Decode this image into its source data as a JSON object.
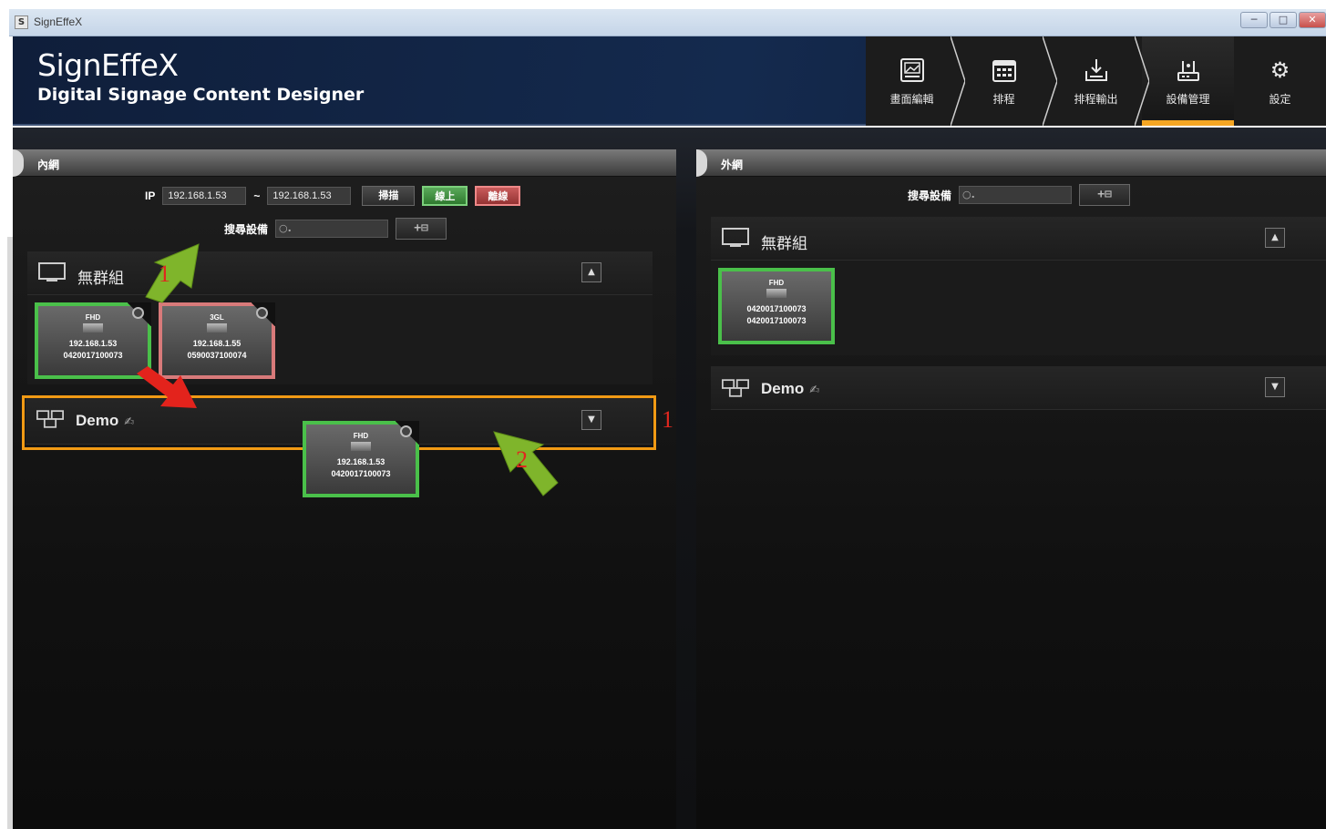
{
  "window": {
    "title": "SignEffeX",
    "icon_letter": "S",
    "controls": [
      "─",
      "□",
      "✕"
    ]
  },
  "header": {
    "brand": "SignEffeX",
    "tagline": "Digital Signage Content Designer"
  },
  "nav": [
    {
      "label": "畫面編輯",
      "icon": "image-edit-icon",
      "active": false
    },
    {
      "label": "排程",
      "icon": "calendar-icon",
      "active": false
    },
    {
      "label": "排程輸出",
      "icon": "download-icon",
      "active": false
    },
    {
      "label": "設備管理",
      "icon": "network-device-icon",
      "active": true
    },
    {
      "label": "設定",
      "icon": "gear-icon",
      "active": false
    }
  ],
  "left_panel": {
    "title": "內網",
    "ip_label": "IP",
    "ip_start": "192.168.1.53",
    "ip_separator": "~",
    "ip_end": "192.168.1.53",
    "scan_button": "掃描",
    "online_button": "線上",
    "offline_button": "離線",
    "search_label": "搜尋設備",
    "search_placeholder": "",
    "add_group_glyph": "+⊟",
    "ungrouped": {
      "name": "無群組",
      "toggle": "▲",
      "devices": [
        {
          "res": "FHD",
          "line1": "192.168.1.53",
          "line2": "0420017100073",
          "status": "online"
        },
        {
          "res": "3GL",
          "line1": "192.168.1.55",
          "line2": "0590037100074",
          "status": "offline"
        }
      ]
    },
    "demo_group": {
      "name": "Demo",
      "toggle": "▼",
      "dragged_device": {
        "res": "FHD",
        "line1": "192.168.1.53",
        "line2": "0420017100073"
      }
    },
    "annotations": {
      "arrow_1": "1",
      "arrow_2": "2",
      "outline_1": "1"
    }
  },
  "right_panel": {
    "title": "外網",
    "search_label": "搜尋設備",
    "search_placeholder": "",
    "add_group_glyph": "+⊟",
    "ungrouped": {
      "name": "無群組",
      "toggle": "▲",
      "devices": [
        {
          "res": "FHD",
          "line1": "0420017100073",
          "line2": "0420017100073",
          "status": "online"
        }
      ]
    },
    "demo_group": {
      "name": "Demo",
      "toggle": "▼"
    }
  },
  "colors": {
    "accent_orange": "#f5a623",
    "online_green": "#4ac04a",
    "offline_red": "#d87a7a",
    "annotation_arrow_green": "#7fb52b",
    "annotation_arrow_red": "#e3231c"
  }
}
